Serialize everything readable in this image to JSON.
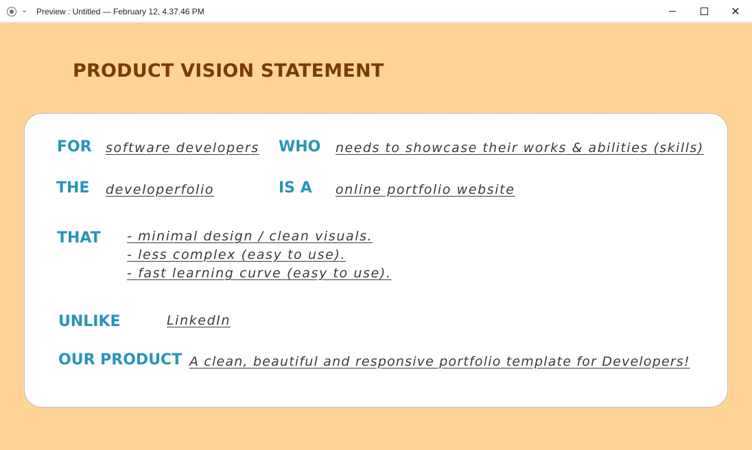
{
  "window": {
    "title": "Preview : Untitled — February 12, 4.37.46 PM",
    "app_icon": "record-icon",
    "controls": {
      "minimize": "—",
      "maximize": "□",
      "close": "✕"
    }
  },
  "page": {
    "title": "PRODUCT VISION STATEMENT",
    "background_color": "#ffd496",
    "title_color": "#7a3b05",
    "label_color": "#2b93b8"
  },
  "vision": {
    "for_label": "FOR",
    "for_value": "software developers",
    "who_label": "WHO",
    "who_value": "needs to showcase their works & abilities (skills)",
    "the_label": "THE",
    "the_value": "developerfolio",
    "isa_label": "IS A",
    "isa_value": "online portfolio website",
    "that_label": "THAT",
    "that_items": [
      "- minimal design / clean visuals.",
      "- less complex (easy to use).",
      "- fast learning curve (easy to use)."
    ],
    "unlike_label": "UNLIKE",
    "unlike_value": "LinkedIn",
    "product_label": "OUR PRODUCT",
    "product_value": "A clean, beautiful and responsive portfolio template for Developers!"
  }
}
